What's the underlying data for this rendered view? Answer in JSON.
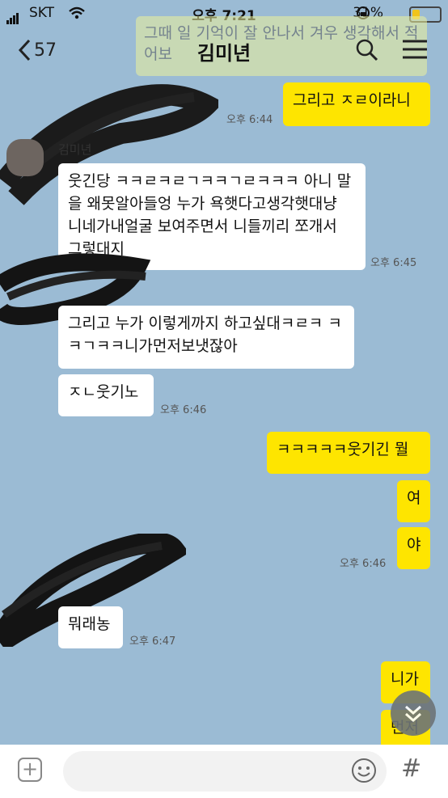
{
  "status": {
    "carrier": "SKT",
    "time": "오후 7:21",
    "battery": "31%"
  },
  "header": {
    "back_count": "57",
    "title": "김미년"
  },
  "ghost_text": "그때 일 기억이 잘 안나서 겨우 생각해서 적어보",
  "messages": {
    "m1": {
      "text": "그리고 ㅈㄹ이라니",
      "time": "오후 6:44"
    },
    "sender_name": "김미년",
    "m2": {
      "text": "웃긴당 ㅋㅋㄹㅋㄹㄱㅋㅋㄱㄹㅋㅋㅋ 아니 말을 왜못알아들엉 누가 욕햇다고생각햇대냥 니네가내얼굴 보여주면서 니들끼리 쪼개서 그렇대지",
      "time": "오후 6:45"
    },
    "m3": {
      "text": "그리고 누가 이렇게까지 하고싶대ㅋㄹㅋ ㅋㅋㄱㅋㅋ니가먼저보냇잖아"
    },
    "m4": {
      "text": "ㅈㄴ웃기노",
      "time": "오후 6:46"
    },
    "m5": {
      "text": "ㅋㅋㅋㅋㅋ웃기긴 뭘"
    },
    "m6": {
      "text": "여"
    },
    "m7": {
      "text": "야",
      "time": "오후 6:46"
    },
    "m8": {
      "text": "뭐래농",
      "time": "오후 6:47"
    },
    "m9": {
      "text": "니가"
    },
    "m10": {
      "text": "먼저"
    }
  },
  "icons": {
    "back": "chevron-left-icon",
    "search": "search-icon",
    "menu": "hamburger-menu-icon",
    "scroll_down": "chevron-double-down-icon",
    "plus": "plus-icon",
    "emoji": "emoji-icon",
    "hash": "hash-icon"
  },
  "colors": {
    "background": "#9bbbd4",
    "my_bubble": "#fee500",
    "other_bubble": "#ffffff"
  }
}
